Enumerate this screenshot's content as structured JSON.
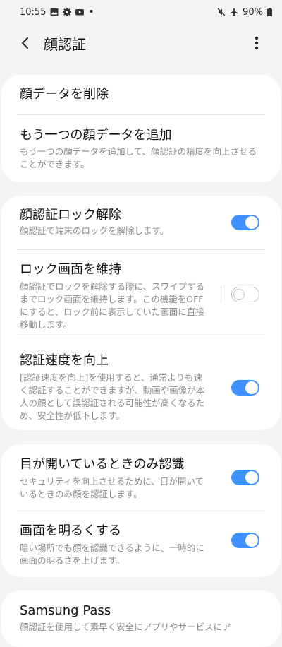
{
  "status": {
    "time": "10:55",
    "dot": "•",
    "battery": "90%"
  },
  "header": {
    "title": "顔認証"
  },
  "card1": {
    "delete_face": "顔データを削除",
    "add_face_title": "もう一つの顔データを追加",
    "add_face_desc": "もう一つの顔データを追加して、顔認証の精度を向上させることができます。"
  },
  "card2": {
    "unlock_title": "顔認証ロック解除",
    "unlock_desc": "顔認証で端末のロックを解除します。",
    "unlock_on": true,
    "stay_title": "ロック画面を維持",
    "stay_desc": "顔認証でロックを解除する際に、スワイプするまでロック画面を維持します。この機能をOFFにすると、ロック前に表示していた画面に直接移動します。",
    "stay_on": false,
    "faster_title": "認証速度を向上",
    "faster_desc": "[認証速度を向上]を使用すると、通常よりも速く認証することができますが、動画や画像が本人の顔として誤認証される可能性が高くなるため、安全性が低下します。",
    "faster_on": true
  },
  "card3": {
    "eyes_title": "目が開いているときのみ認識",
    "eyes_desc": "セキュリティを向上させるために、目が開いているときのみ顔を認証します。",
    "eyes_on": true,
    "brighten_title": "画面を明るくする",
    "brighten_desc": "暗い場所でも顔を認識できるように、一時的に画面の明るさを上げます。",
    "brighten_on": true
  },
  "card4": {
    "pass_title": "Samsung Pass",
    "pass_desc": "顔認証を使用して素早く安全にアプリやサービスにア"
  },
  "icons": {
    "back": "chevron-left-icon",
    "more": "more-vertical-icon",
    "status_left": [
      "image-icon",
      "gear-icon",
      "youtube-icon"
    ],
    "status_right": [
      "mute-icon",
      "airplane-icon",
      "battery-icon"
    ]
  },
  "colors": {
    "accent": "#3e91ff",
    "background": "#f4f4f4",
    "card": "#ffffff"
  }
}
